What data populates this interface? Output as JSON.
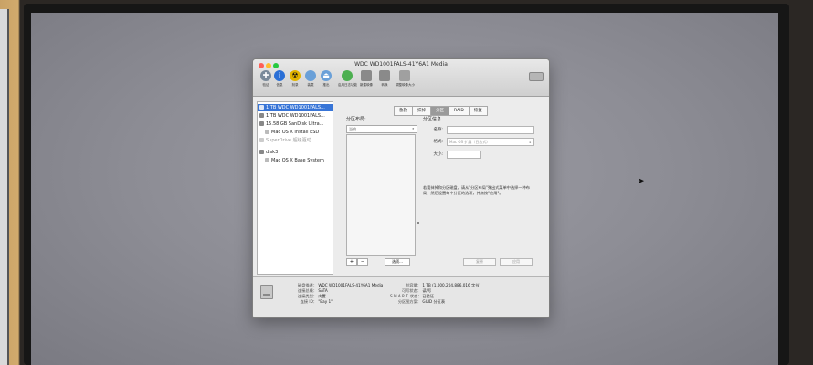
{
  "window": {
    "title": "WDC WD1001FALS-41Y6A1 Media"
  },
  "toolbar": {
    "buttons": [
      {
        "icon": "verify-icon",
        "label": "验证",
        "color": "#7a8a9a"
      },
      {
        "icon": "info-icon",
        "label": "信息",
        "color": "#2a6fd6"
      },
      {
        "icon": "burn-icon",
        "label": "刻录",
        "color": "#e2b400"
      },
      {
        "icon": "mount-icon",
        "label": "装载",
        "color": "#6aa0d8"
      },
      {
        "icon": "eject-icon",
        "label": "推出",
        "color": "#6aa0d8"
      },
      {
        "icon": "enable-journaling-icon",
        "label": "启用日志功能",
        "color": "#4caf50"
      },
      {
        "icon": "new-image-icon",
        "label": "新建映像",
        "color": "#8a8a8a"
      },
      {
        "icon": "convert-icon",
        "label": "转换",
        "color": "#8a8a8a"
      },
      {
        "icon": "resize-image-icon",
        "label": "调整映像大小",
        "color": "#a0a0a0"
      }
    ]
  },
  "sidebar": {
    "items": [
      {
        "label": "1 TB WDC WD1001FALS...",
        "selected": true,
        "dim": false
      },
      {
        "label": "1 TB WDC WD1001FALS...",
        "selected": false,
        "dim": false
      },
      {
        "label": "15.58 GB SanDisk Ultra...",
        "selected": false,
        "dim": false
      },
      {
        "label": "Mac OS X Install ESD",
        "selected": false,
        "dim": false
      },
      {
        "label": "SuperDrive 超级驱动",
        "selected": false,
        "dim": true
      },
      {
        "label": "disk3",
        "selected": false,
        "dim": false
      },
      {
        "label": "Mac OS X Base System",
        "selected": false,
        "dim": false
      }
    ]
  },
  "tabs": [
    {
      "label": "急救",
      "active": false
    },
    {
      "label": "抹掉",
      "active": false
    },
    {
      "label": "分区",
      "active": true
    },
    {
      "label": "RAID",
      "active": false
    },
    {
      "label": "恢复",
      "active": false
    }
  ],
  "partition": {
    "layout_title": "分区布局:",
    "layout_value": "当前",
    "plus": "+",
    "minus": "−",
    "options_button": "选项...",
    "info_title": "分区信息",
    "fields": [
      {
        "label": "名称:",
        "value": ""
      },
      {
        "label": "格式:",
        "value": "Mac OS 扩展（日志式）"
      },
      {
        "label": "大小:",
        "value": ""
      }
    ],
    "description": "若要抹掉和分区磁盘，请从\"分区布局\"弹出式菜单中选择一种布局，然后设置每个分区的选项，并点按\"应用\"。",
    "revert_button": "复原",
    "apply_button": "应用"
  },
  "disk_info": {
    "left": [
      {
        "key": "磁盘描述：",
        "value": "WDC WD1001FALS-41Y6A1 Media"
      },
      {
        "key": "连接总线：",
        "value": "SATA"
      },
      {
        "key": "连接类型：",
        "value": "内置"
      },
      {
        "key": "连接 ID：",
        "value": "\"Bay 1\""
      }
    ],
    "right": [
      {
        "key": "总容量：",
        "value": "1 TB (1,000,204,886,016 字节)"
      },
      {
        "key": "可写状态：",
        "value": "读/写"
      },
      {
        "key": "S.M.A.R.T. 状态：",
        "value": "已验证"
      },
      {
        "key": "分区图方案：",
        "value": "GUID 分区表"
      }
    ]
  }
}
